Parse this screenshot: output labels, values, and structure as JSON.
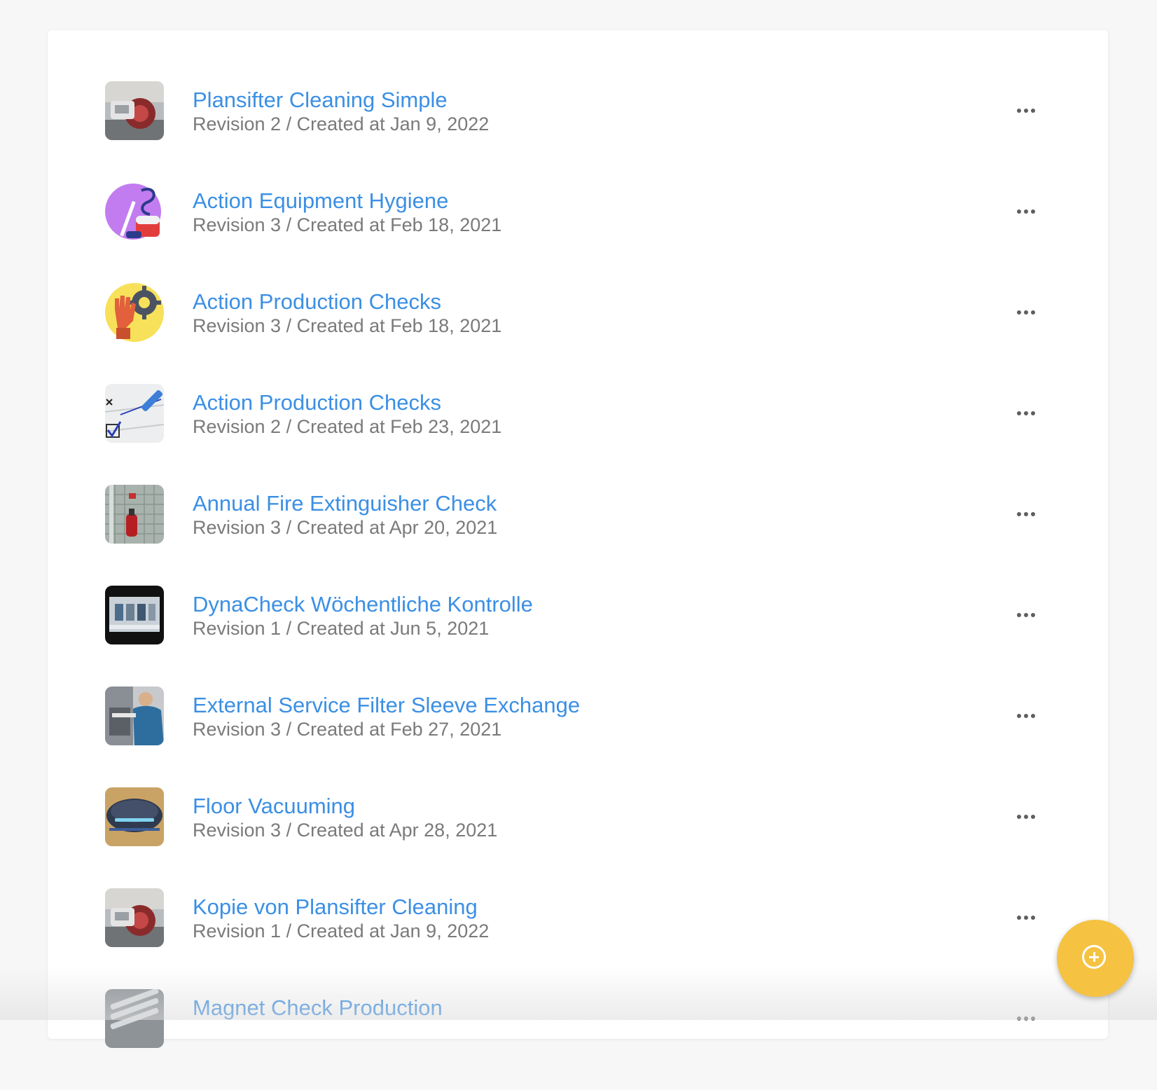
{
  "checklists": [
    {
      "title": "Plansifter Cleaning Simple",
      "meta": "Revision 2 / Created at Jan 9, 2022",
      "icon": "plansifter-photo"
    },
    {
      "title": "Action Equipment Hygiene",
      "meta": "Revision 3 / Created at Feb 18, 2021",
      "icon": "hygiene-illustration"
    },
    {
      "title": "Action Production Checks",
      "meta": "Revision 3 / Created at Feb 18, 2021",
      "icon": "glove-gear-illustration"
    },
    {
      "title": "Action Production Checks",
      "meta": "Revision 2 / Created at Feb 23, 2021",
      "icon": "checkbox-pen-photo"
    },
    {
      "title": "Annual Fire Extinguisher Check",
      "meta": "Revision 3 / Created at Apr 20, 2021",
      "icon": "fire-extinguisher-photo"
    },
    {
      "title": "DynaCheck Wöchentliche Kontrolle",
      "meta": "Revision 1 / Created at Jun 5, 2021",
      "icon": "tablet-screen-photo"
    },
    {
      "title": "External Service Filter Sleeve Exchange",
      "meta": "Revision 3 / Created at Feb 27, 2021",
      "icon": "service-worker-photo"
    },
    {
      "title": "Floor Vacuuming",
      "meta": "Revision 3 / Created at Apr 28, 2021",
      "icon": "robot-vacuum-photo"
    },
    {
      "title": "Kopie von Plansifter Cleaning",
      "meta": "Revision 1 / Created at Jan 9, 2022",
      "icon": "plansifter-photo"
    },
    {
      "title": "Magnet Check Production",
      "meta": "",
      "icon": "magnet-grid-photo"
    }
  ],
  "colors": {
    "link": "#3b8fe4",
    "meta": "#7a7a7a",
    "fab": "#f5c242"
  },
  "fab": {
    "icon": "plus-circle-icon"
  }
}
